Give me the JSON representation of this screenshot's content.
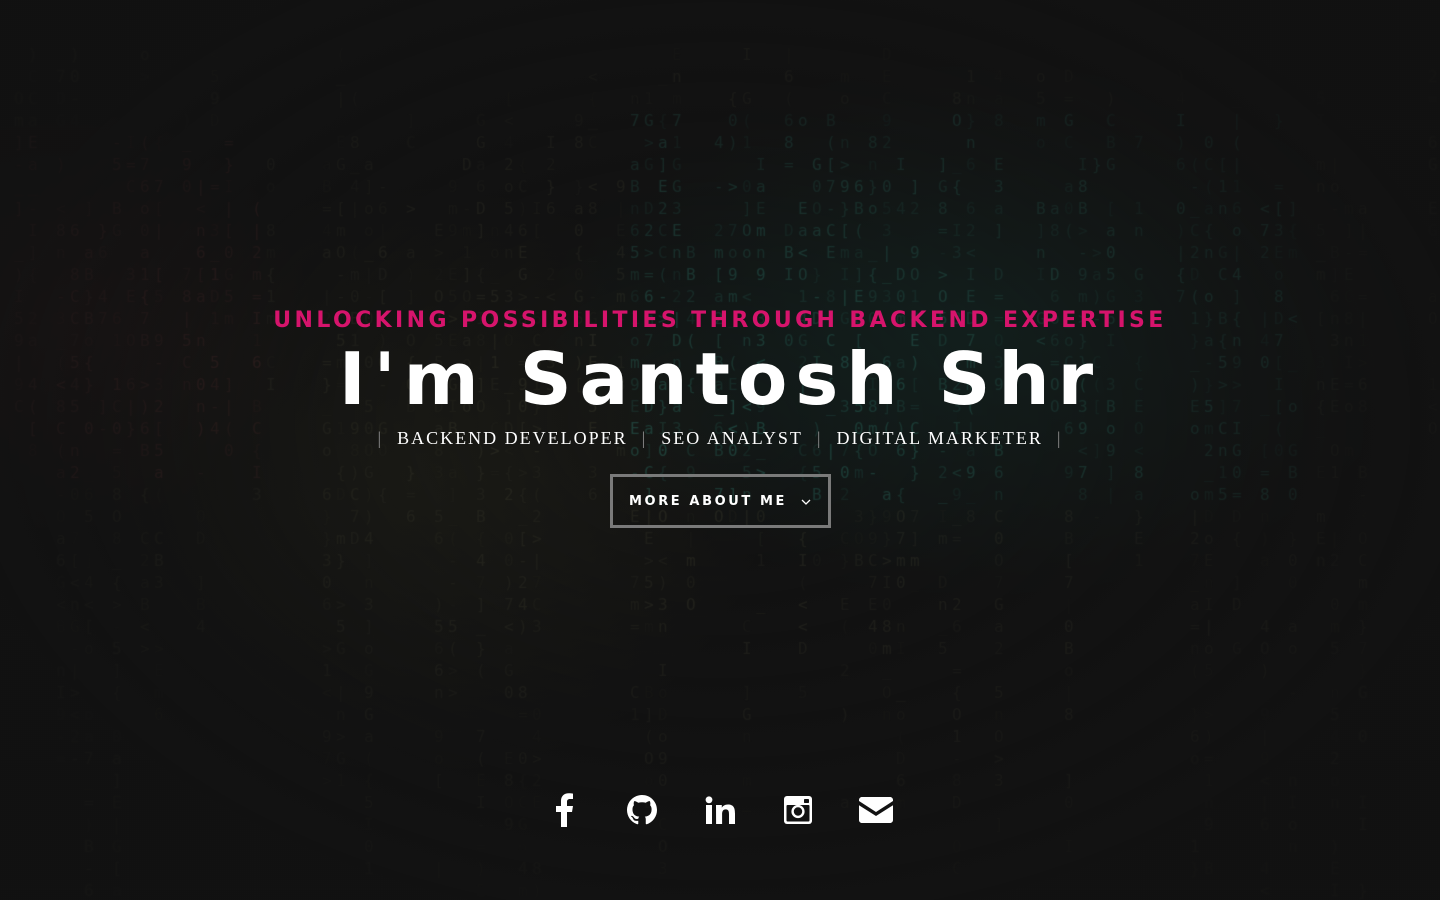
{
  "hero": {
    "tagline": "UNLOCKING POSSIBILITIES THROUGH BACKEND EXPERTISE",
    "headline": "I'm Santosh Shr",
    "roles": [
      "BACKEND DEVELOPER",
      "SEO ANALYST",
      "DIGITAL MARKETER"
    ],
    "role_separator": "|",
    "cta_label": "MORE ABOUT ME",
    "cta_icon": "chevron-down-icon"
  },
  "social": {
    "links": [
      {
        "name": "facebook",
        "icon": "facebook-icon"
      },
      {
        "name": "github",
        "icon": "github-icon"
      },
      {
        "name": "linkedin",
        "icon": "linkedin-icon"
      },
      {
        "name": "instagram",
        "icon": "instagram-icon"
      },
      {
        "name": "email",
        "icon": "envelope-icon"
      }
    ]
  },
  "colors": {
    "background": "#121212",
    "accent": "#d6146c",
    "text": "#ffffff",
    "button_border": "#7a7a7a",
    "separator": "#8a8a8a"
  }
}
